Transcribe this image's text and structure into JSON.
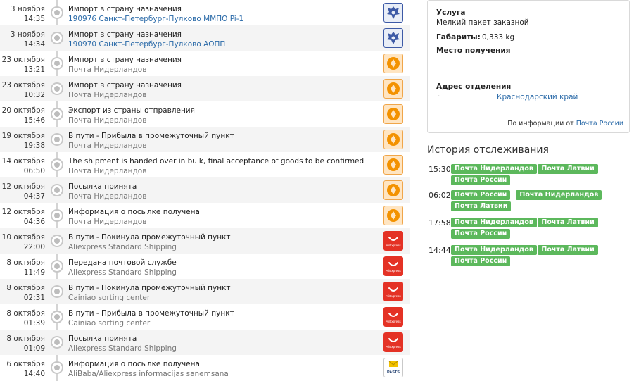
{
  "events": [
    {
      "date": "3 ноября",
      "time": "14:35",
      "title": "Импорт в страну назначения",
      "sub": "190976 Санкт-Петербург-Пулково ММПО Pi-1",
      "sub_link": true,
      "carrier": "russian-post"
    },
    {
      "date": "3 ноября",
      "time": "14:34",
      "title": "Импорт в страну назначения",
      "sub": "190970 Санкт-Петербург-Пулково АОПП",
      "sub_link": true,
      "carrier": "russian-post"
    },
    {
      "date": "23 октября",
      "time": "13:21",
      "title": "Импорт в страну назначения",
      "sub": "Почта Нидерландов",
      "sub_link": false,
      "carrier": "postnl"
    },
    {
      "date": "23 октября",
      "time": "10:32",
      "title": "Импорт в страну назначения",
      "sub": "Почта Нидерландов",
      "sub_link": false,
      "carrier": "postnl"
    },
    {
      "date": "20 октября",
      "time": "15:46",
      "title": "Экспорт из страны отправления",
      "sub": "Почта Нидерландов",
      "sub_link": false,
      "carrier": "postnl"
    },
    {
      "date": "19 октября",
      "time": "19:38",
      "title": "В пути - Прибыла в промежуточный пункт",
      "sub": "Почта Нидерландов",
      "sub_link": false,
      "carrier": "postnl"
    },
    {
      "date": "14 октября",
      "time": "06:50",
      "title": "The shipment is handed over in bulk, final acceptance of goods to be confirmed",
      "sub": "Почта Нидерландов",
      "sub_link": false,
      "carrier": "postnl"
    },
    {
      "date": "12 октября",
      "time": "04:37",
      "title": "Посылка принята",
      "sub": "Почта Нидерландов",
      "sub_link": false,
      "carrier": "postnl"
    },
    {
      "date": "12 октября",
      "time": "04:36",
      "title": "Информация о посылке получена",
      "sub": "Почта Нидерландов",
      "sub_link": false,
      "carrier": "postnl"
    },
    {
      "date": "10 октября",
      "time": "22:00",
      "title": "В пути - Покинула промежуточный пункт",
      "sub": "Aliexpress Standard Shipping",
      "sub_link": false,
      "carrier": "aliexpress"
    },
    {
      "date": "8 октября",
      "time": "11:49",
      "title": "Передана почтовой службе",
      "sub": "Aliexpress Standard Shipping",
      "sub_link": false,
      "carrier": "aliexpress"
    },
    {
      "date": "8 октября",
      "time": "02:31",
      "title": "В пути - Покинула промежуточный пункт",
      "sub": "Cainiao sorting center",
      "sub_link": false,
      "carrier": "aliexpress"
    },
    {
      "date": "8 октября",
      "time": "01:39",
      "title": "В пути - Прибыла в промежуточный пункт",
      "sub": "Cainiao sorting center",
      "sub_link": false,
      "carrier": "aliexpress"
    },
    {
      "date": "8 октября",
      "time": "01:09",
      "title": "Посылка принята",
      "sub": "Aliexpress Standard Shipping",
      "sub_link": false,
      "carrier": "aliexpress"
    },
    {
      "date": "6 октября",
      "time": "14:40",
      "title": "Информация о посылке получена",
      "sub": "AliBaba/Aliexpress informacijas sanemsana",
      "sub_link": false,
      "carrier": "latvijas-pasts"
    }
  ],
  "carrier_labels": {
    "aliexpress": "AliExpress",
    "latvijas_pasts": "PASTS"
  },
  "info": {
    "service_label": "Услуга",
    "service_value": "Мелкий пакет заказной",
    "dims_label": "Габариты:",
    "dims_value": "0,333 kg",
    "place_label": "Место получения",
    "address_label": "Адрес отделения",
    "address_dot": ".",
    "address_value": "Краснодарский край",
    "note_prefix": "По информации от",
    "note_link": "Почта России"
  },
  "history": {
    "title": "История отслеживания",
    "rows": [
      {
        "time": "15:30",
        "badges": [
          "Почта Нидерландов",
          "Почта Латвии",
          "Почта России"
        ]
      },
      {
        "time": "06:02",
        "badges": [
          "Почта России",
          "Почта Нидерландов",
          "Почта Латвии"
        ]
      },
      {
        "time": "17:58",
        "badges": [
          "Почта Нидерландов",
          "Почта Латвии",
          "Почта России"
        ]
      },
      {
        "time": "14:44",
        "badges": [
          "Почта Нидерландов",
          "Почта Латвии",
          "Почта России"
        ]
      }
    ]
  },
  "colors": {
    "badge": "#5cb85c",
    "link": "#2a6aa8",
    "aliexpress": "#e43225",
    "postnl": "#f0a64a",
    "russian_post": "#3d5aa6"
  }
}
